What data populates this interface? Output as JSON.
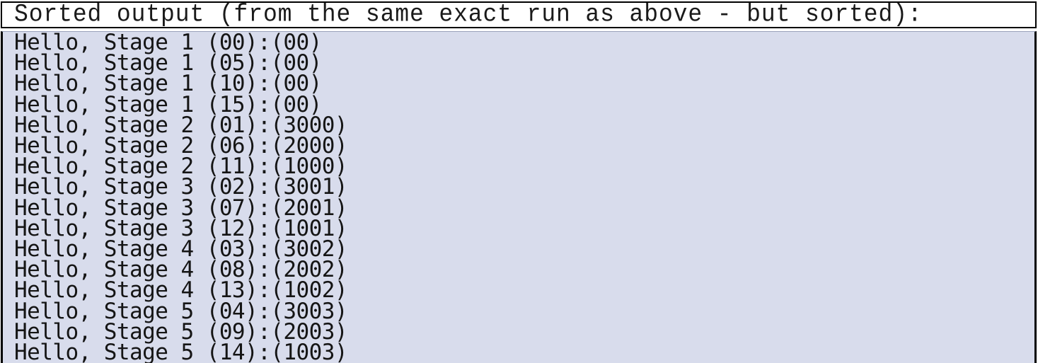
{
  "caption": {
    "text": "Sorted output (from the same exact run as above - but sorted):"
  },
  "colors": {
    "console_background": "#d8dcec",
    "caption_background": "#ffffff",
    "border": "#000000",
    "text": "#151515"
  },
  "console": {
    "lines": [
      "Hello, Stage 1 (00):(00)",
      "Hello, Stage 1 (05):(00)",
      "Hello, Stage 1 (10):(00)",
      "Hello, Stage 1 (15):(00)",
      "Hello, Stage 2 (01):(3000)",
      "Hello, Stage 2 (06):(2000)",
      "Hello, Stage 2 (11):(1000)",
      "Hello, Stage 3 (02):(3001)",
      "Hello, Stage 3 (07):(2001)",
      "Hello, Stage 3 (12):(1001)",
      "Hello, Stage 4 (03):(3002)",
      "Hello, Stage 4 (08):(2002)",
      "Hello, Stage 4 (13):(1002)",
      "Hello, Stage 5 (04):(3003)",
      "Hello, Stage 5 (09):(2003)",
      "Hello, Stage 5 (14):(1003)"
    ]
  }
}
